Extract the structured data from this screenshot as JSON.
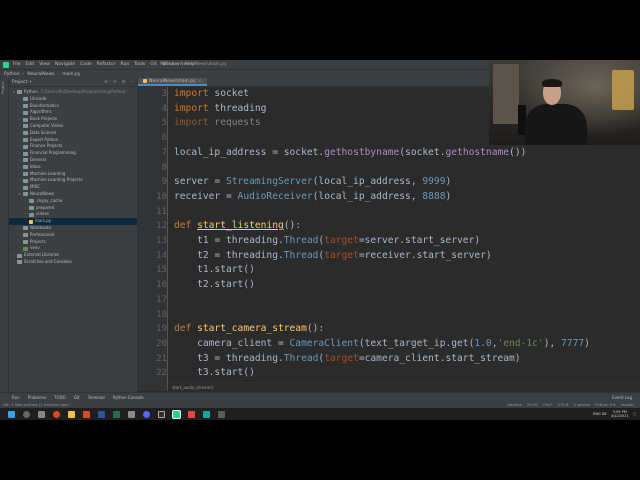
{
  "menu": {
    "items": [
      "File",
      "Edit",
      "View",
      "Navigate",
      "Code",
      "Refactor",
      "Run",
      "Tools",
      "Git",
      "Window",
      "Help"
    ],
    "window_title": "Python - NeuralNews\\main.py"
  },
  "nav": {
    "crumbs": [
      "Python",
      "NeuralNews",
      "main.py"
    ]
  },
  "project_panel": {
    "title": "Project",
    "tree": [
      {
        "label": "Python",
        "path": "C:\\Users\\flo\\Desktop\\Programming\\Python",
        "depth": 0,
        "open": true
      },
      {
        "label": "Unicode",
        "depth": 1
      },
      {
        "label": "Bioinformatics",
        "depth": 1
      },
      {
        "label": "Algorithms",
        "depth": 1
      },
      {
        "label": "Book Projects",
        "depth": 1
      },
      {
        "label": "Computer Vision",
        "depth": 1
      },
      {
        "label": "Data Science",
        "depth": 1
      },
      {
        "label": "Expert Python",
        "depth": 1
      },
      {
        "label": "Finance Projects",
        "depth": 1
      },
      {
        "label": "Financial Programming",
        "depth": 1
      },
      {
        "label": "General",
        "depth": 1
      },
      {
        "label": "Ideas",
        "depth": 1
      },
      {
        "label": "Machine Learning",
        "depth": 1
      },
      {
        "label": "Machine Learning Projects",
        "depth": 1
      },
      {
        "label": "MISC",
        "depth": 1
      },
      {
        "label": "NeuralNews",
        "depth": 1,
        "open": true
      },
      {
        "label": ".mypy_cache",
        "depth": 2
      },
      {
        "label": "prepared",
        "depth": 2
      },
      {
        "label": "videos",
        "depth": 2
      },
      {
        "label": "main.py",
        "depth": 2,
        "file": true,
        "selected": true
      },
      {
        "label": "Notebooks",
        "depth": 1
      },
      {
        "label": "Professional",
        "depth": 1
      },
      {
        "label": "Projects",
        "depth": 1
      },
      {
        "label": "venv",
        "depth": 1
      },
      {
        "label": "External Libraries",
        "depth": 0
      },
      {
        "label": "Scratches and Consoles",
        "depth": 0
      }
    ]
  },
  "editor": {
    "tab_label": "NeuralNews\\main.py",
    "line_numbers": [
      "3",
      "4",
      "5",
      "6",
      "7",
      "8",
      "9",
      "10",
      "11",
      "12",
      "13",
      "14",
      "15",
      "16",
      "17",
      "18",
      "19",
      "20",
      "21",
      "22"
    ],
    "breadcrumb": "start_audio_stream()"
  },
  "code": {
    "l3_kw": "import",
    "l3_mod": " socket",
    "l4_kw": "import",
    "l4_mod": " threading",
    "l5_kw": "import",
    "l5_mod": " requests",
    "l7_a": "local_ip_address = socket.",
    "l7_fn": "gethostbyname",
    "l7_b": "(socket.",
    "l7_fn2": "gethostname",
    "l7_c": "())",
    "l9_a": "server = ",
    "l9_cls": "StreamingServer",
    "l9_b": "(local_ip_address, ",
    "l9_num": "9999",
    "l9_c": ")",
    "l10_a": "receiver = ",
    "l10_cls": "AudioReceiver",
    "l10_b": "(local_ip_address, ",
    "l10_num": "8888",
    "l10_c": ")",
    "l12_kw": "def",
    "l12_fn": "start_listening",
    "l12_b": "():",
    "l13_a": "    t1 = threading.",
    "l13_cls": "Thread",
    "l13_b": "(",
    "l13_p": "target",
    "l13_c": "=server.start_server)",
    "l14_a": "    t2 = threading.",
    "l14_cls": "Thread",
    "l14_b": "(",
    "l14_p": "target",
    "l14_c": "=receiver.start_server)",
    "l15": "    t1.start()",
    "l16": "    t2.start()",
    "l19_kw": "def",
    "l19_fn": "start_camera_stream",
    "l19_b": "():",
    "l20_a": "    camera_client = ",
    "l20_cls": "CameraClient",
    "l20_b": "(text_target_ip.get(",
    "l20_num": "1.0",
    "l20_c": ",",
    "l20_str": "'end-1c'",
    "l20_d": "), ",
    "l20_num2": "7777",
    "l20_e": ")",
    "l21_a": "    t3 = threading.",
    "l21_cls": "Thread",
    "l21_b": "(",
    "l21_p": "target",
    "l21_c": "=camera_client.start_stream)",
    "l22": "    t3.start()"
  },
  "bottom_tools": {
    "items": [
      "Run",
      "Problems",
      "TODO",
      "Git",
      "Terminal",
      "Python Console"
    ],
    "right": "Event Log"
  },
  "status": {
    "left": "Git: 1 files pushed (2 minutes ago)",
    "right": [
      "tabnine",
      "20:30",
      "CRLF",
      "UTF-8",
      "4 spaces",
      "Python 3.9",
      "master"
    ]
  },
  "taskbar": {
    "time": "3:59 PM",
    "date": "4/12/2021",
    "lang": "ENG DE"
  }
}
